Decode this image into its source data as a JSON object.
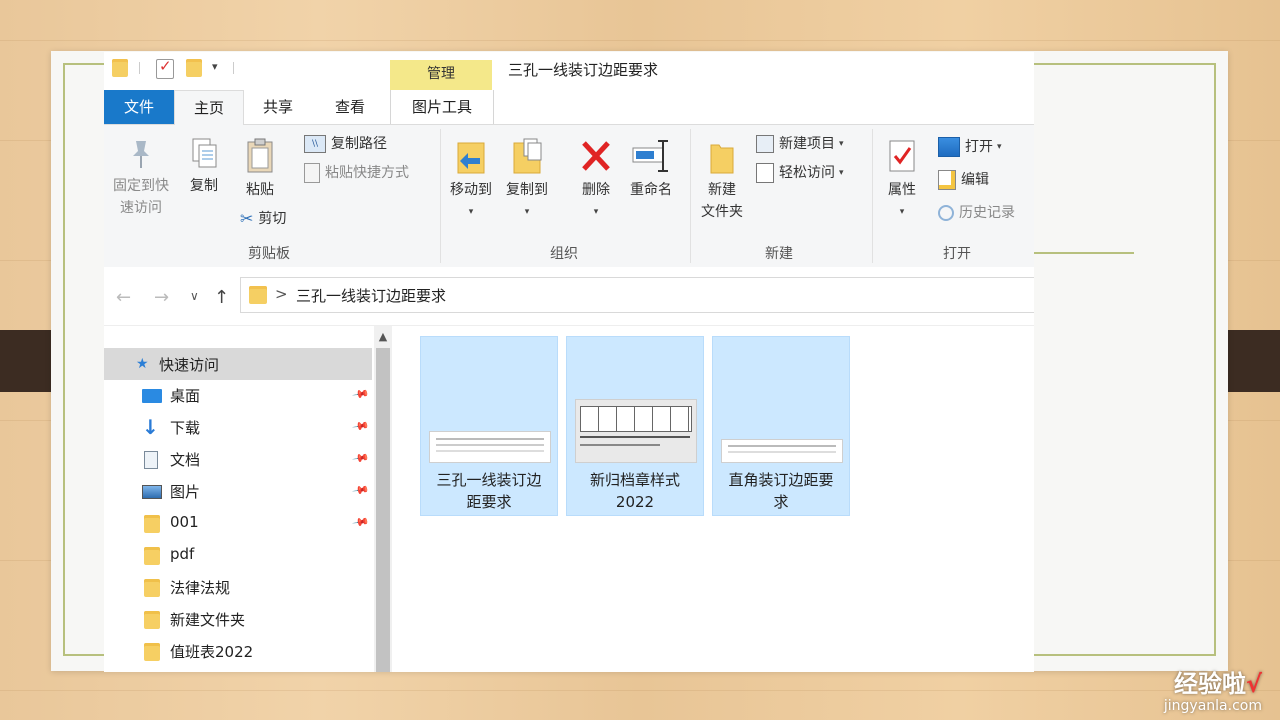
{
  "window": {
    "title": "三孔一线装订边距要求",
    "context_tab": "管理"
  },
  "tabs": [
    {
      "label": "文件"
    },
    {
      "label": "主页"
    },
    {
      "label": "共享"
    },
    {
      "label": "查看"
    },
    {
      "label": "图片工具"
    }
  ],
  "ribbon": {
    "clipboard": {
      "group_label": "剪贴板",
      "pin_line1": "固定到快",
      "pin_line2": "速访问",
      "copy": "复制",
      "paste": "粘贴",
      "copy_path": "复制路径",
      "paste_shortcut": "粘贴快捷方式",
      "cut": "剪切"
    },
    "organize": {
      "group_label": "组织",
      "move_to": "移动到",
      "copy_to": "复制到",
      "delete": "删除",
      "rename": "重命名"
    },
    "new": {
      "group_label": "新建",
      "new_folder_line1": "新建",
      "new_folder_line2": "文件夹",
      "new_item": "新建项目",
      "easy_access": "轻松访问"
    },
    "open": {
      "group_label": "打开",
      "properties": "属性",
      "open": "打开",
      "edit": "编辑",
      "history": "历史记录"
    }
  },
  "address": {
    "breadcrumb": "三孔一线装订边距要求",
    "separator": ">"
  },
  "nav_pane": {
    "quick_access": "快速访问",
    "items": [
      {
        "label": "桌面",
        "icon": "desktop-icon",
        "pinned": true
      },
      {
        "label": "下载",
        "icon": "download-icon",
        "pinned": true
      },
      {
        "label": "文档",
        "icon": "document-icon",
        "pinned": true
      },
      {
        "label": "图片",
        "icon": "pictures-icon",
        "pinned": true
      },
      {
        "label": "001",
        "icon": "folder-icon",
        "pinned": true
      },
      {
        "label": "pdf",
        "icon": "folder-icon",
        "pinned": false
      },
      {
        "label": "法律法规",
        "icon": "folder-icon",
        "pinned": false
      },
      {
        "label": "新建文件夹",
        "icon": "folder-icon",
        "pinned": false
      },
      {
        "label": "值班表2022",
        "icon": "folder-icon",
        "pinned": false
      }
    ]
  },
  "files": [
    {
      "line1": "三孔一线装订边",
      "line2": "距要求"
    },
    {
      "line1": "新归档章样式",
      "line2": "2022"
    },
    {
      "line1": "直角装订边距要",
      "line2": "求"
    }
  ],
  "watermark": {
    "brand": "经验啦",
    "check": "√",
    "url": "jingyanla.com"
  },
  "colors": {
    "file_tab": "#1979ca",
    "manage_tab": "#f4e88a",
    "selection": "#cce8ff",
    "folder": "#f5cf63"
  }
}
